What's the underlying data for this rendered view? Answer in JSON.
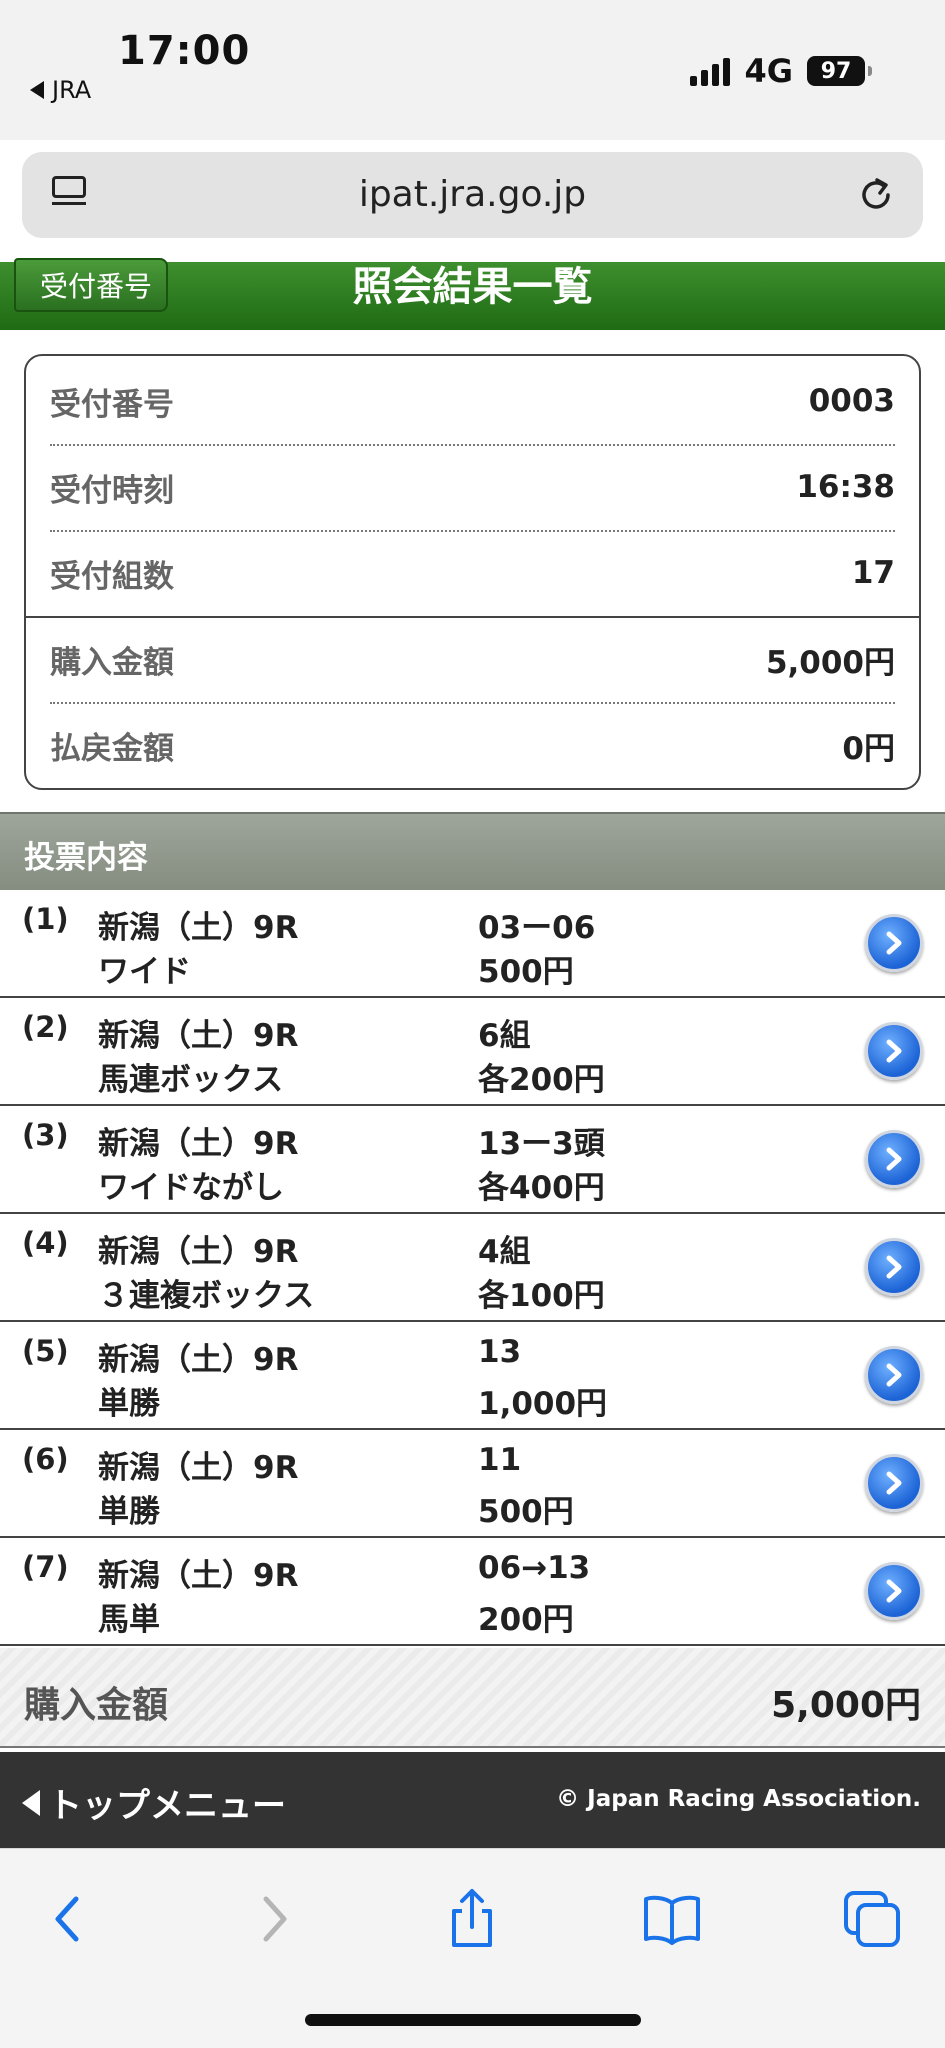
{
  "status_bar": {
    "time": "17:00",
    "back_app": "JRA",
    "network": "4G",
    "battery": "97"
  },
  "browser": {
    "url": "ipat.jra.go.jp"
  },
  "header": {
    "back_label": "受付番号",
    "title": "照会結果一覧"
  },
  "summary": [
    {
      "label": "受付番号",
      "value": "0003"
    },
    {
      "label": "受付時刻",
      "value": "16:38"
    },
    {
      "label": "受付組数",
      "value": "17"
    },
    {
      "label": "購入金額",
      "value": "5,000円"
    },
    {
      "label": "払戻金額",
      "value": "0円"
    }
  ],
  "section_title": "投票内容",
  "bets": [
    {
      "num": "(1)",
      "race": "新潟（土）9R",
      "type": "ワイド",
      "combo": "03ー06",
      "amount": "500円"
    },
    {
      "num": "(2)",
      "race": "新潟（土）9R",
      "type": "馬連ボックス",
      "combo": "6組",
      "amount": "各200円"
    },
    {
      "num": "(3)",
      "race": "新潟（土）9R",
      "type": "ワイドながし",
      "combo": "13ー3頭",
      "amount": "各400円"
    },
    {
      "num": "(4)",
      "race": "新潟（土）9R",
      "type": "３連複ボックス",
      "combo": "4組",
      "amount": "各100円"
    },
    {
      "num": "(5)",
      "race": "新潟（土）9R",
      "type": "単勝",
      "combo": "13",
      "amount": "1,000円"
    },
    {
      "num": "(6)",
      "race": "新潟（土）9R",
      "type": "単勝",
      "combo": "11",
      "amount": "500円"
    },
    {
      "num": "(7)",
      "race": "新潟（土）9R",
      "type": "馬単",
      "combo": "06→13",
      "amount": "200円"
    }
  ],
  "total": {
    "label": "購入金額",
    "value": "5,000円"
  },
  "footer": {
    "top_menu": "トップメニュー",
    "copyright": "© Japan Racing Association."
  },
  "colors": {
    "header_green": "#2a7a1c",
    "section_gray": "#8f978b",
    "footer_dark": "#333333",
    "arrow_blue": "#1c63d6",
    "ios_blue": "#1a73e8"
  }
}
